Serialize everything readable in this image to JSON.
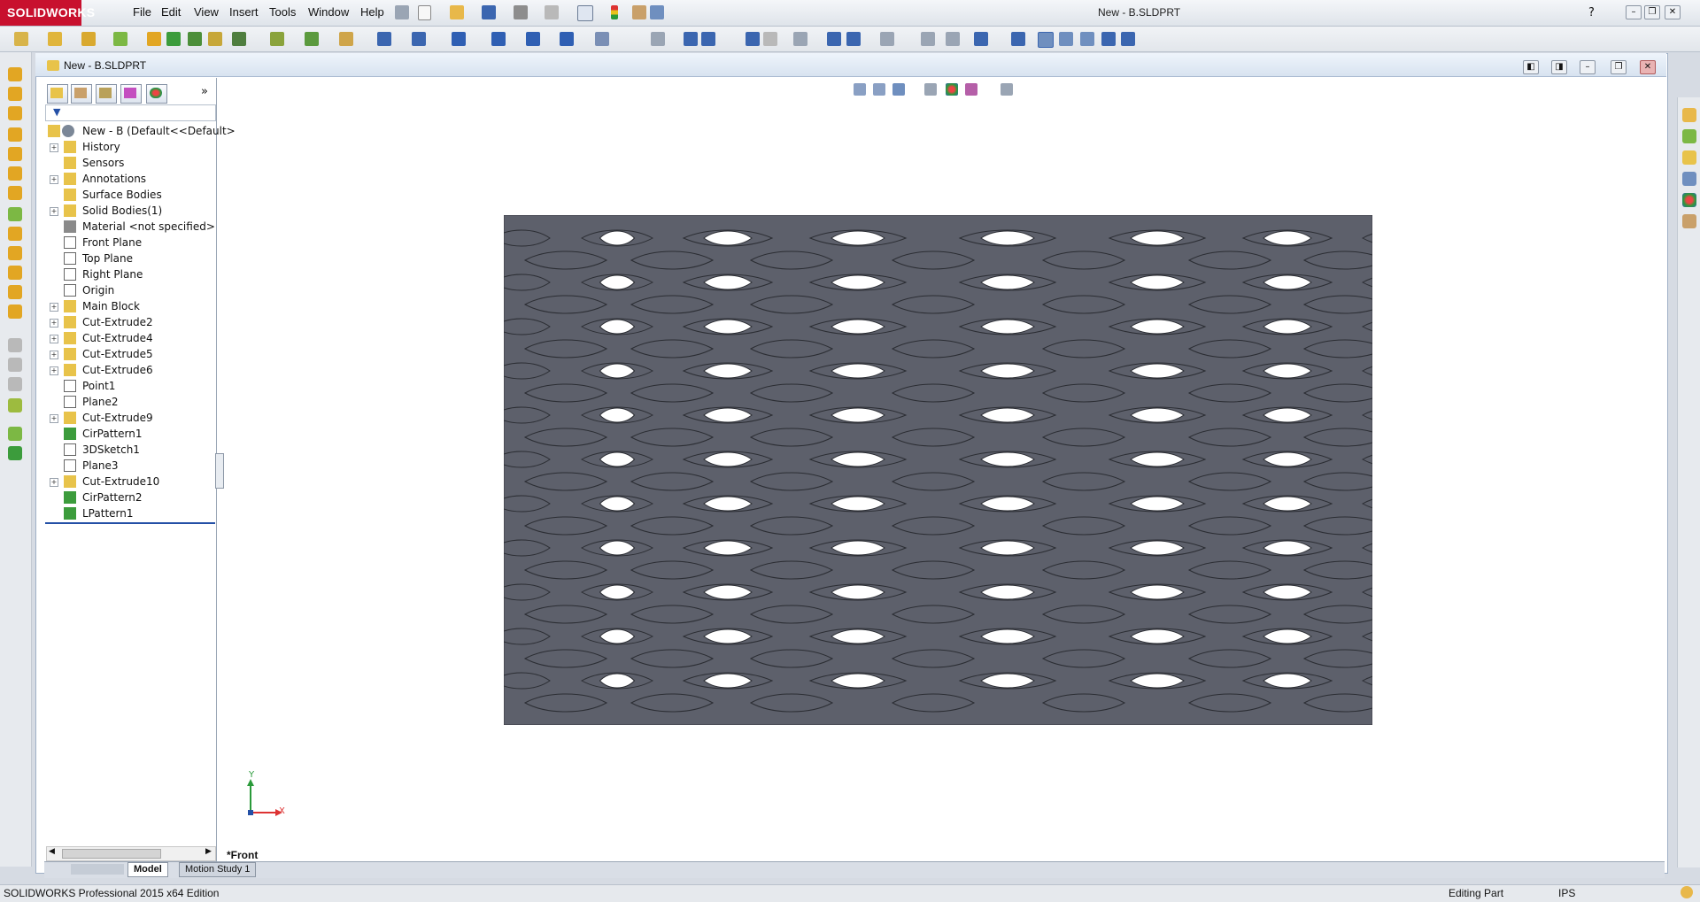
{
  "app": {
    "brand": "SOLIDWORKS",
    "brand_color": "#c8102e",
    "document_title": "New - B.SLDPRT"
  },
  "menu": [
    "File",
    "Edit",
    "View",
    "Insert",
    "Tools",
    "Window",
    "Help"
  ],
  "document_window": {
    "title": "New - B.SLDPRT"
  },
  "feature_manager": {
    "tabs": [
      "feature-manager-tab",
      "property-manager-tab",
      "configuration-manager-tab",
      "dimxpert-manager-tab",
      "display-manager-tab"
    ],
    "root": "New - B  (Default<<Default>",
    "items": [
      {
        "label": "History",
        "icon": "history-folder-icon",
        "expandable": true
      },
      {
        "label": "Sensors",
        "icon": "sensors-icon",
        "expandable": false
      },
      {
        "label": "Annotations",
        "icon": "annotations-icon",
        "expandable": true
      },
      {
        "label": "Surface Bodies",
        "icon": "surface-bodies-icon",
        "expandable": false
      },
      {
        "label": "Solid Bodies(1)",
        "icon": "solid-bodies-icon",
        "expandable": true
      },
      {
        "label": "Material <not specified>",
        "icon": "material-icon",
        "expandable": false
      },
      {
        "label": "Front Plane",
        "icon": "plane-icon",
        "expandable": false
      },
      {
        "label": "Top Plane",
        "icon": "plane-icon",
        "expandable": false
      },
      {
        "label": "Right Plane",
        "icon": "plane-icon",
        "expandable": false
      },
      {
        "label": "Origin",
        "icon": "origin-icon",
        "expandable": false
      },
      {
        "label": "Main Block",
        "icon": "extrude-feature-icon",
        "expandable": true
      },
      {
        "label": "Cut-Extrude2",
        "icon": "cut-extrude-icon",
        "expandable": true
      },
      {
        "label": "Cut-Extrude4",
        "icon": "cut-extrude-icon",
        "expandable": true
      },
      {
        "label": "Cut-Extrude5",
        "icon": "cut-extrude-icon",
        "expandable": true
      },
      {
        "label": "Cut-Extrude6",
        "icon": "cut-extrude-icon",
        "expandable": true
      },
      {
        "label": "Point1",
        "icon": "point-icon",
        "expandable": false
      },
      {
        "label": "Plane2",
        "icon": "plane-icon",
        "expandable": false
      },
      {
        "label": "Cut-Extrude9",
        "icon": "cut-extrude-icon",
        "expandable": true
      },
      {
        "label": "CirPattern1",
        "icon": "circular-pattern-icon",
        "expandable": false
      },
      {
        "label": "3DSketch1",
        "icon": "3d-sketch-icon",
        "expandable": false
      },
      {
        "label": "Plane3",
        "icon": "plane-icon",
        "expandable": false
      },
      {
        "label": "Cut-Extrude10",
        "icon": "cut-extrude-icon",
        "expandable": true
      },
      {
        "label": "CirPattern2",
        "icon": "circular-pattern-icon",
        "expandable": false
      },
      {
        "label": "LPattern1",
        "icon": "linear-pattern-icon",
        "expandable": false
      }
    ]
  },
  "viewport": {
    "view_label": "*Front",
    "triad_x": "X",
    "triad_y": "Y",
    "part_color": "#5d606b",
    "background": "#ffffff"
  },
  "bottom_tabs": [
    "Model",
    "Motion Study 1"
  ],
  "status": {
    "left": "SOLIDWORKS Professional 2015 x64 Edition",
    "mode": "Editing Part",
    "units": "IPS"
  }
}
